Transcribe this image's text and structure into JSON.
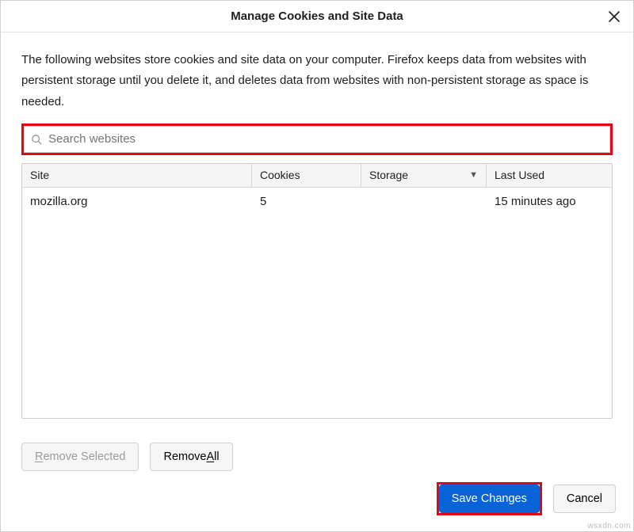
{
  "header": {
    "title": "Manage Cookies and Site Data"
  },
  "body": {
    "description": "The following websites store cookies and site data on your computer. Firefox keeps data from websites with persistent storage until you delete it, and deletes data from websites with non-persistent storage as space is needed.",
    "search_placeholder": "Search websites"
  },
  "table": {
    "columns": [
      "Site",
      "Cookies",
      "Storage",
      "Last Used"
    ],
    "sorted_column": "Storage",
    "sort_direction": "desc",
    "rows": [
      {
        "site": "mozilla.org",
        "cookies": "5",
        "storage": "",
        "last_used": "15 minutes ago"
      }
    ]
  },
  "buttons": {
    "remove_selected_ul": "R",
    "remove_selected_rest": "emove Selected",
    "remove_all_pre": "Remove ",
    "remove_all_ul": "A",
    "remove_all_post": "ll",
    "save": "Save Changes",
    "cancel": "Cancel"
  },
  "highlights": [
    "search-field",
    "save-changes-button"
  ],
  "watermark": "wsxdn.com"
}
